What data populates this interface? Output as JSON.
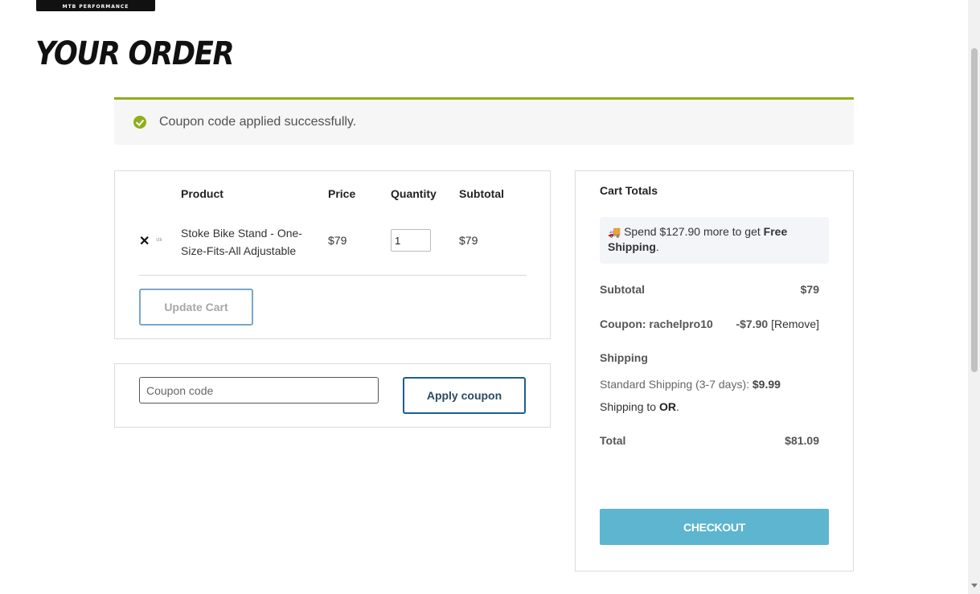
{
  "logo": {
    "text": "MTB PERFORMANCE"
  },
  "page": {
    "title": "YOUR ORDER"
  },
  "notice": {
    "message": "Coupon code applied successfully."
  },
  "cart": {
    "headers": {
      "product": "Product",
      "price": "Price",
      "quantity": "Quantity",
      "subtotal": "Subtotal"
    },
    "items": [
      {
        "remove": "✕",
        "thumb": "stk",
        "name": "Stoke Bike Stand - One-Size-Fits-All Adjustable",
        "price": "$79",
        "quantity": "1",
        "subtotal": "$79"
      }
    ],
    "update_label": "Update Cart"
  },
  "coupon": {
    "placeholder": "Coupon code",
    "apply_label": "Apply coupon"
  },
  "totals": {
    "title": "Cart Totals",
    "promo": {
      "icon": "truck-icon",
      "prefix": "Spend ",
      "amount": "$127.90",
      "middle": " more to get ",
      "strong": "Free Shipping",
      "suffix": "."
    },
    "subtotal_label": "Subtotal",
    "subtotal_value": "$79",
    "coupon_label": "Coupon: rachelpro10",
    "coupon_value": "-$7.90",
    "coupon_remove": "[Remove]",
    "shipping_label": "Shipping",
    "shipping_method": "Standard Shipping (3-7 days): ",
    "shipping_cost": "$9.99",
    "ship_to_prefix": "Shipping to ",
    "ship_to_state": "OR",
    "ship_to_suffix": ".",
    "total_label": "Total",
    "total_value": "$81.09",
    "checkout_label": "CHECKOUT"
  },
  "colors": {
    "notice_accent": "#8fae1b",
    "checkout_bg": "#5db5cf",
    "apply_border": "#1d5e8e"
  }
}
